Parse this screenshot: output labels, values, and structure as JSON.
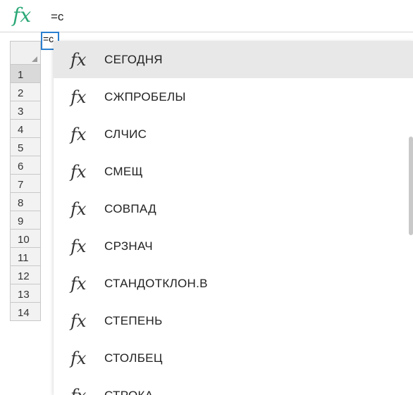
{
  "formula_bar": {
    "icon": "fx-icon",
    "formula": "=c"
  },
  "active_cell": {
    "value": "=c"
  },
  "row_numbers": [
    "1",
    "2",
    "3",
    "4",
    "5",
    "6",
    "7",
    "8",
    "9",
    "10",
    "11",
    "12",
    "13",
    "14"
  ],
  "suggestions": [
    {
      "label": "СЕГОДНЯ"
    },
    {
      "label": "СЖПРОБЕЛЫ"
    },
    {
      "label": "СЛЧИС"
    },
    {
      "label": "СМЕЩ"
    },
    {
      "label": "СОВПАД"
    },
    {
      "label": "СРЗНАЧ"
    },
    {
      "label": "СТАНДОТКЛОН.В"
    },
    {
      "label": "СТЕПЕНЬ"
    },
    {
      "label": "СТОЛБЕЦ"
    },
    {
      "label": "СТРОКА"
    }
  ],
  "colors": {
    "fx_accent": "#2aa876",
    "selection_border": "#2a7fd0",
    "highlight": "#e8e8e8"
  }
}
